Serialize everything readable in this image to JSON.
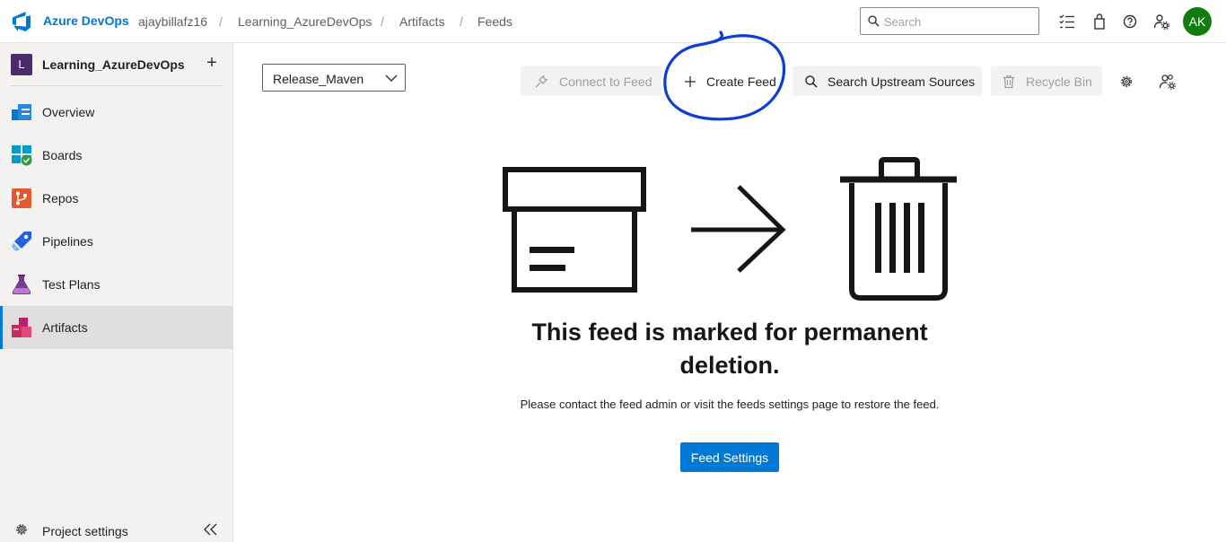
{
  "header": {
    "brand": "Azure DevOps",
    "breadcrumbs": [
      "ajaybillafz16",
      "Learning_AzureDevOps",
      "Artifacts",
      "Feeds"
    ],
    "search_placeholder": "Search",
    "avatar_initials": "AK",
    "icons": [
      "task-list-icon",
      "shopping-bag-icon",
      "help-icon",
      "user-settings-icon"
    ]
  },
  "sidebar": {
    "project_initial": "L",
    "project_name": "Learning_AzureDevOps",
    "items": [
      {
        "label": "Overview",
        "icon": "overview-icon"
      },
      {
        "label": "Boards",
        "icon": "boards-icon"
      },
      {
        "label": "Repos",
        "icon": "repos-icon"
      },
      {
        "label": "Pipelines",
        "icon": "pipelines-icon"
      },
      {
        "label": "Test Plans",
        "icon": "test-plans-icon"
      },
      {
        "label": "Artifacts",
        "icon": "artifacts-icon",
        "active": true
      }
    ],
    "settings_label": "Project settings"
  },
  "toolbar": {
    "feed_selected": "Release_Maven",
    "connect_label": "Connect to Feed",
    "create_label": "Create Feed",
    "search_upstream_label": "Search Upstream Sources",
    "recycle_label": "Recycle Bin"
  },
  "main": {
    "title": "This feed is marked for permanent deletion.",
    "body": "Please contact the feed admin or visit the feeds settings page to restore the feed.",
    "button_label": "Feed Settings"
  },
  "colors": {
    "accent": "#0078d4",
    "avatar": "#107c10",
    "project_badge": "#4b2a6d",
    "annotation": "#0a3fd6"
  }
}
